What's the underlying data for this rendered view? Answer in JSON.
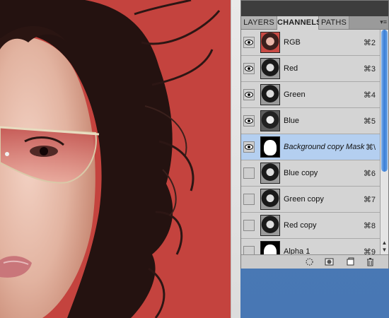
{
  "panel": {
    "tabs": [
      {
        "label": "LAYERS",
        "active": false
      },
      {
        "label": "CHANNELS",
        "active": true
      },
      {
        "label": "PATHS",
        "active": false
      }
    ],
    "channels": [
      {
        "name": "RGB",
        "shortcut": "⌘2",
        "visible": true,
        "thumb": "rgb-thumbnail"
      },
      {
        "name": "Red",
        "shortcut": "⌘3",
        "visible": true,
        "thumb": "grayscale-thumbnail"
      },
      {
        "name": "Green",
        "shortcut": "⌘4",
        "visible": true,
        "thumb": "grayscale-thumbnail"
      },
      {
        "name": "Blue",
        "shortcut": "⌘5",
        "visible": true,
        "thumb": "grayscale-thumbnail"
      },
      {
        "name": "Background copy Mask",
        "shortcut": "⌘\\",
        "visible": true,
        "selected": true,
        "thumb": "mask-thumbnail"
      },
      {
        "name": "Blue copy",
        "shortcut": "⌘6",
        "visible": false,
        "thumb": "grayscale-thumbnail"
      },
      {
        "name": "Green copy",
        "shortcut": "⌘7",
        "visible": false,
        "thumb": "grayscale-thumbnail"
      },
      {
        "name": "Red copy",
        "shortcut": "⌘8",
        "visible": false,
        "thumb": "grayscale-thumbnail"
      },
      {
        "name": "Alpha 1",
        "shortcut": "⌘9",
        "visible": false,
        "thumb": "mask-thumbnail"
      }
    ],
    "bottom_icons": [
      "load-selection-icon",
      "save-selection-icon",
      "new-channel-icon",
      "delete-channel-icon"
    ]
  },
  "colors": {
    "canvas_background": "#c4433e",
    "selection_highlight": "#b4cff0",
    "desktop": "#4f7bb7"
  }
}
